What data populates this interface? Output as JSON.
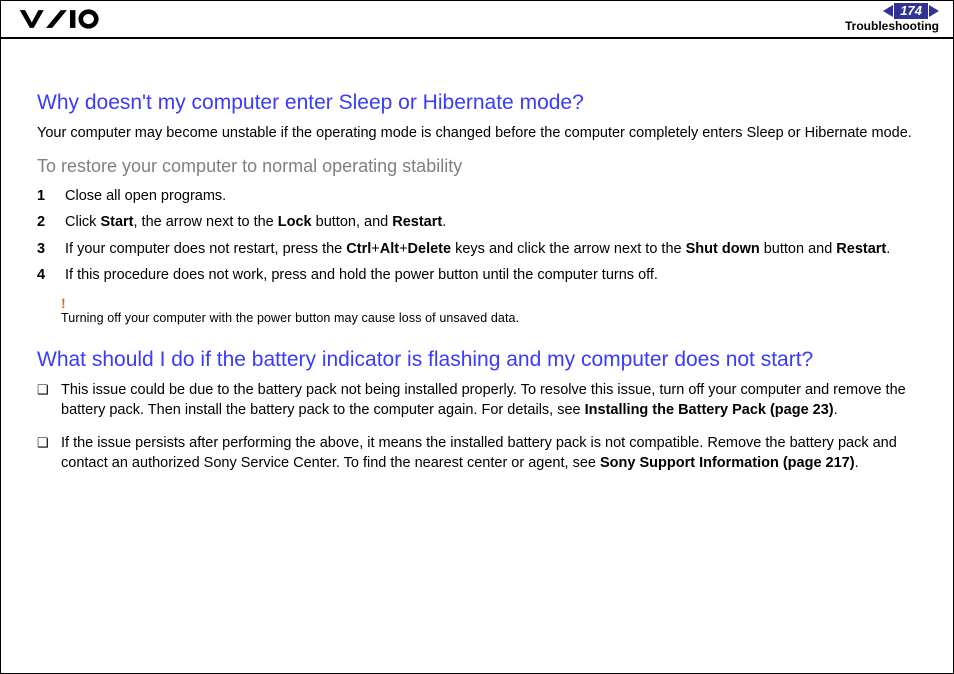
{
  "header": {
    "page_number": "174",
    "section": "Troubleshooting"
  },
  "q1": {
    "title": "Why doesn't my computer enter Sleep or Hibernate mode?",
    "intro": "Your computer may become unstable if the operating mode is changed before the computer completely enters Sleep or Hibernate mode.",
    "subhead": "To restore your computer to normal operating stability",
    "steps": {
      "s1": "Close all open programs.",
      "s2_a": "Click ",
      "s2_b": "Start",
      "s2_c": ", the arrow next to the ",
      "s2_d": "Lock",
      "s2_e": " button, and ",
      "s2_f": "Restart",
      "s2_g": ".",
      "s3_a": "If your computer does not restart, press the ",
      "s3_b": "Ctrl",
      "s3_c": "+",
      "s3_d": "Alt",
      "s3_e": "+",
      "s3_f": "Delete",
      "s3_g": " keys and click the arrow next to the ",
      "s3_h": "Shut down",
      "s3_i": " button and ",
      "s3_j": "Restart",
      "s3_k": ".",
      "s4": "If this procedure does not work, press and hold the power button until the computer turns off."
    },
    "warn_mark": "!",
    "warn_msg": "Turning off your computer with the power button may cause loss of unsaved data."
  },
  "q2": {
    "title": "What should I do if the battery indicator is flashing and my computer does not start?",
    "b1_a": "This issue could be due to the battery pack not being installed properly. To resolve this issue, turn off your computer and remove the battery pack. Then install the battery pack to the computer again. For details, see ",
    "b1_b": "Installing the Battery Pack (page 23)",
    "b1_c": ".",
    "b2_a": "If the issue persists after performing the above, it means the installed battery pack is not compatible. Remove the battery pack and contact an authorized Sony Service Center. To find the nearest center or agent, see ",
    "b2_b": "Sony Support Information (page 217)",
    "b2_c": "."
  }
}
